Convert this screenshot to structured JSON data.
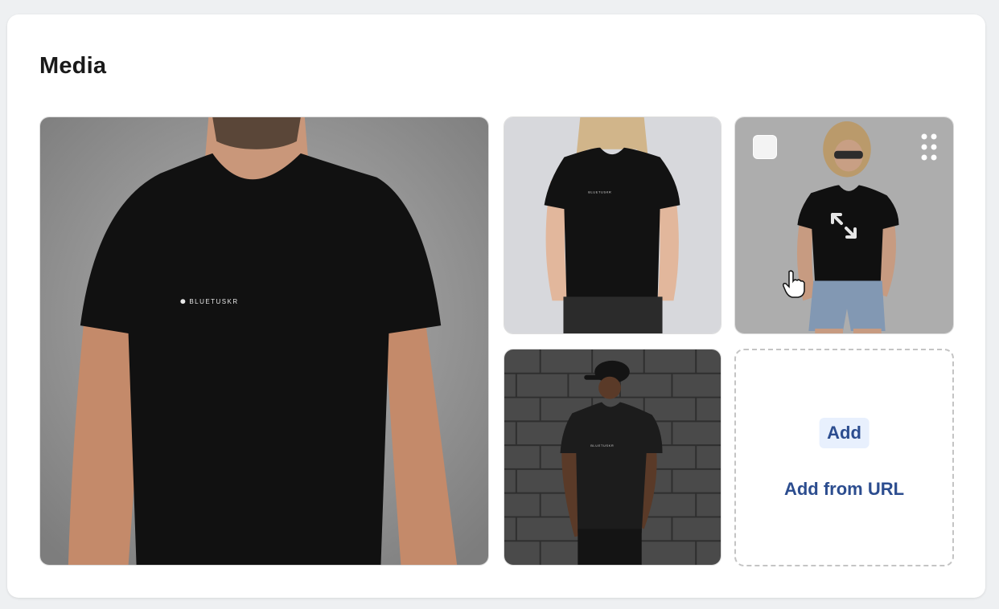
{
  "section": {
    "title": "Media"
  },
  "media": {
    "brand_print": "BLUETUSKR",
    "items": [
      {
        "id": "main",
        "subject": "man-black-tshirt-closeup"
      },
      {
        "id": "a",
        "subject": "woman-black-tshirt-jeans"
      },
      {
        "id": "b",
        "subject": "woman-black-tshirt-shorts-sunglasses"
      },
      {
        "id": "c",
        "subject": "man-black-tshirt-cap-brick-wall"
      }
    ]
  },
  "upload": {
    "add_label": "Add",
    "add_from_url_label": "Add from URL"
  },
  "colors": {
    "accent": "#2c4d8f",
    "add_button_bg": "#e8f0fd",
    "card_bg": "#ffffff",
    "page_bg": "#eef0f2"
  }
}
